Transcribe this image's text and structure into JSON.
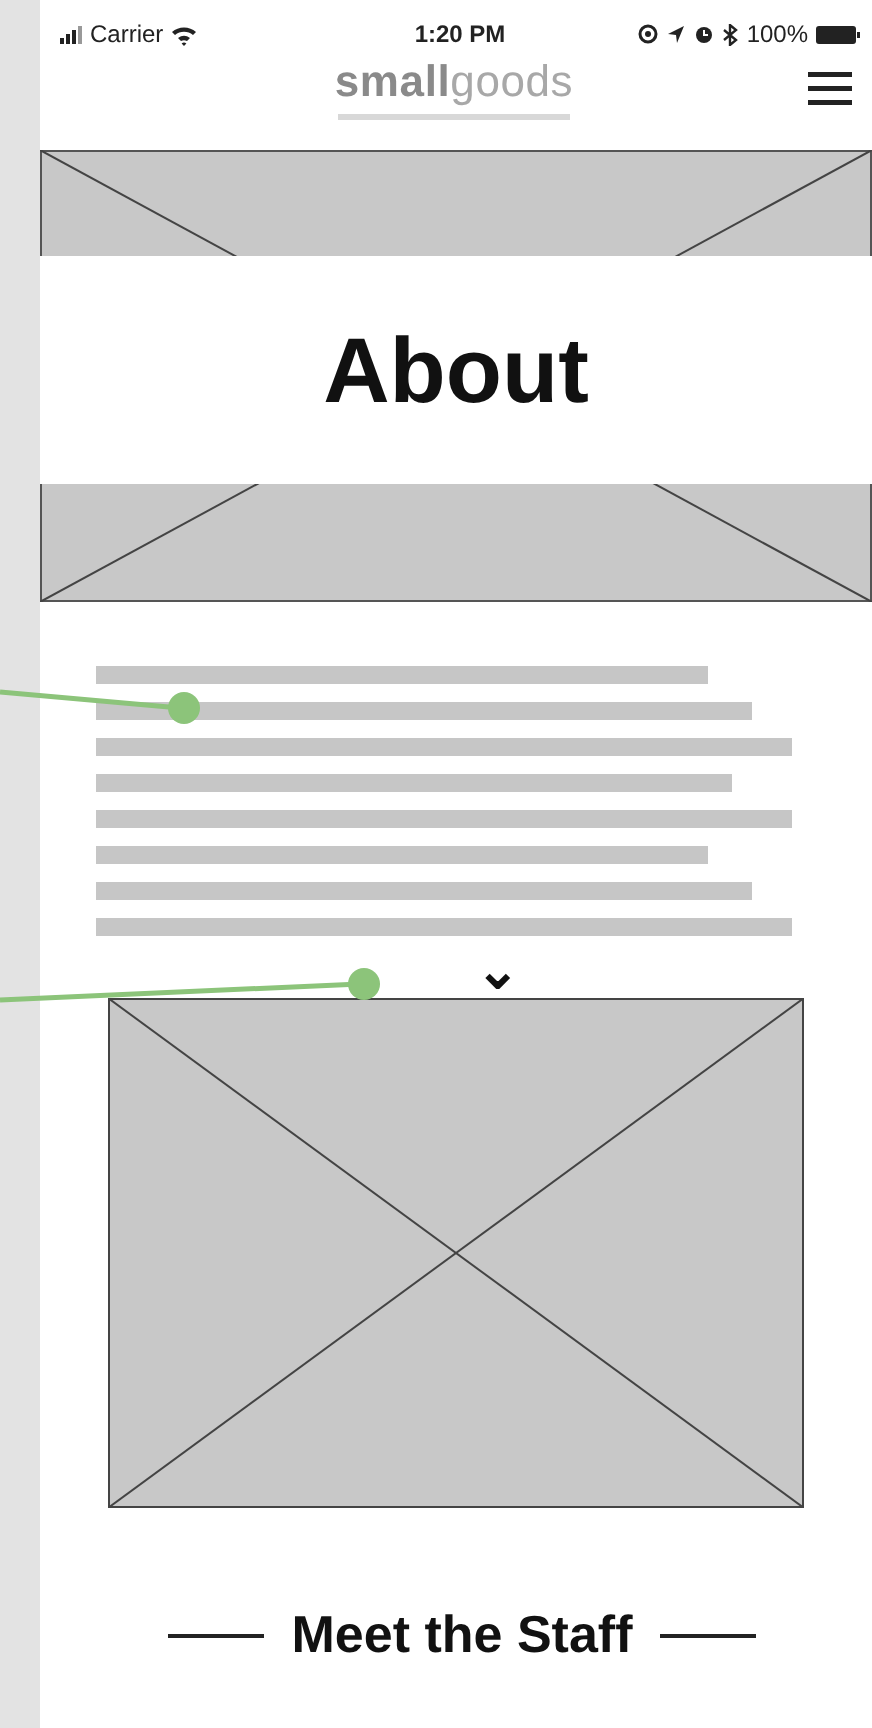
{
  "status_bar": {
    "carrier": "Carrier",
    "time": "1:20 PM",
    "battery": "100%"
  },
  "header": {
    "logo": "**small**goods"
  },
  "hero": {
    "title": "About"
  },
  "about": {
    "expand_icon": "⌄"
  },
  "staff": {
    "heading": "Meet the Staff"
  }
}
